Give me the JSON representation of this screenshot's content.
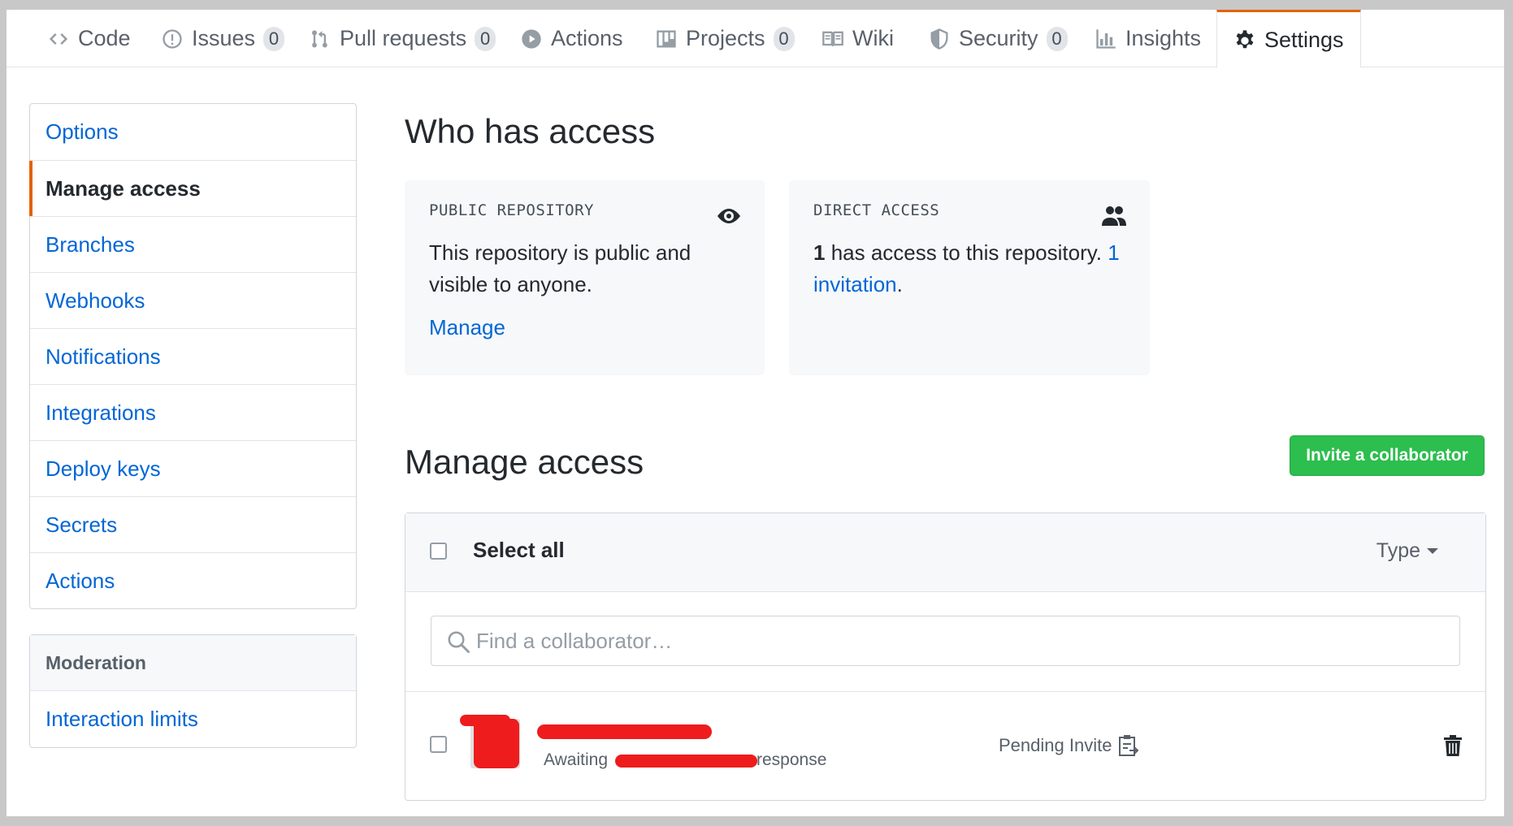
{
  "nav": {
    "tabs": [
      {
        "label": "Code",
        "icon": "code-icon"
      },
      {
        "label": "Issues",
        "count": "0",
        "icon": "issue-icon"
      },
      {
        "label": "Pull requests",
        "count": "0",
        "icon": "pull-request-icon"
      },
      {
        "label": "Actions",
        "icon": "play-icon"
      },
      {
        "label": "Projects",
        "count": "0",
        "icon": "project-icon"
      },
      {
        "label": "Wiki",
        "icon": "book-icon"
      },
      {
        "label": "Security",
        "count": "0",
        "icon": "shield-icon"
      },
      {
        "label": "Insights",
        "icon": "graph-icon"
      },
      {
        "label": "Settings",
        "icon": "gear-icon",
        "selected": true
      }
    ]
  },
  "sidebar": {
    "items": [
      {
        "label": "Options"
      },
      {
        "label": "Manage access",
        "selected": true
      },
      {
        "label": "Branches"
      },
      {
        "label": "Webhooks"
      },
      {
        "label": "Notifications"
      },
      {
        "label": "Integrations"
      },
      {
        "label": "Deploy keys"
      },
      {
        "label": "Secrets"
      },
      {
        "label": "Actions"
      }
    ],
    "moderation": {
      "heading": "Moderation",
      "items": [
        {
          "label": "Interaction limits"
        }
      ]
    }
  },
  "who_has_access": {
    "title": "Who has access",
    "public_card": {
      "label": "PUBLIC REPOSITORY",
      "text": "This repository is public and visible to anyone.",
      "link": "Manage",
      "icon": "eye-icon"
    },
    "direct_card": {
      "label": "DIRECT ACCESS",
      "count": "1",
      "text": " has access to this repository. ",
      "invitation_link": "1 invitation",
      "suffix": ".",
      "icon": "people-icon"
    }
  },
  "manage_access": {
    "title": "Manage access",
    "invite_button": "Invite a collaborator",
    "select_all": "Select all",
    "type_filter": "Type",
    "search_placeholder": "Find a collaborator…",
    "rows": [
      {
        "sub_prefix": "Awaiting",
        "sub_suffix": "response",
        "status": "Pending Invite",
        "status_icon": "clipboard-icon"
      }
    ]
  },
  "colors": {
    "accent": "#e36209",
    "link": "#0366d6",
    "primary_button": "#2cbe4e",
    "redaction": "#ee1c1c"
  }
}
